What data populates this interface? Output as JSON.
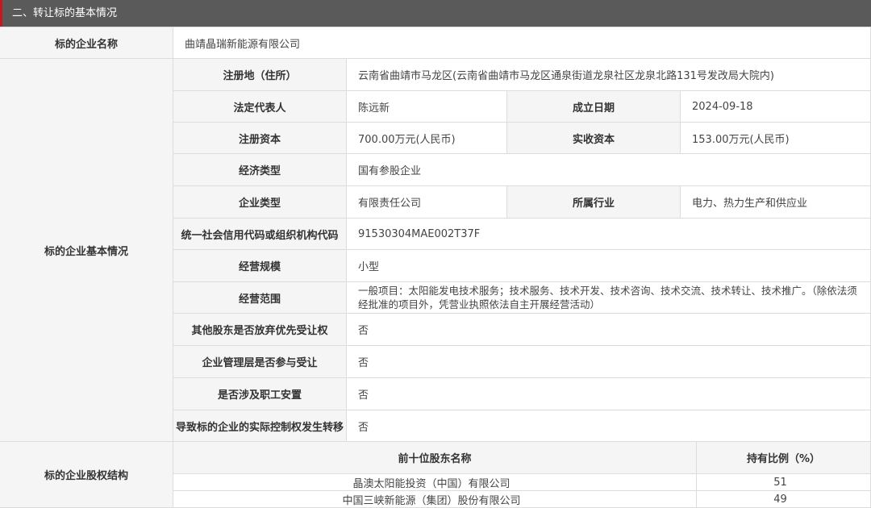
{
  "section": {
    "title": "二、转让标的基本情况"
  },
  "company_name": {
    "label": "标的企业名称",
    "value": "曲靖晶瑞新能源有限公司"
  },
  "basic": {
    "group_label": "标的企业基本情况",
    "registered_address": {
      "label": "注册地（住所）",
      "value": "云南省曲靖市马龙区(云南省曲靖市马龙区通泉街道龙泉社区龙泉北路131号发改局大院内)"
    },
    "legal_rep": {
      "label": "法定代表人",
      "value": "陈远新"
    },
    "established": {
      "label": "成立日期",
      "value": "2024-09-18"
    },
    "registered_capital": {
      "label": "注册资本",
      "value": "700.00万元(人民币)"
    },
    "paid_capital": {
      "label": "实收资本",
      "value": "153.00万元(人民币)"
    },
    "economic_type": {
      "label": "经济类型",
      "value": "国有参股企业"
    },
    "enterprise_type": {
      "label": "企业类型",
      "value": "有限责任公司"
    },
    "industry": {
      "label": "所属行业",
      "value": "电力、热力生产和供应业"
    },
    "credit_code": {
      "label": "统一社会信用代码或组织机构代码",
      "value": "91530304MAE002T37F"
    },
    "scale": {
      "label": "经营规模",
      "value": "小型"
    },
    "business_scope": {
      "label": "经营范围",
      "value": "一般项目：太阳能发电技术服务；技术服务、技术开发、技术咨询、技术交流、技术转让、技术推广。（除依法须经批准的项目外，凭营业执照依法自主开展经营活动）"
    },
    "waive_preemption": {
      "label": "其他股东是否放弃优先受让权",
      "value": "否"
    },
    "mgmt_participate": {
      "label": "企业管理层是否参与受让",
      "value": "否"
    },
    "staff_resettlement": {
      "label": "是否涉及职工安置",
      "value": "否"
    },
    "control_transfer": {
      "label": "导致标的企业的实际控制权发生转移",
      "value": "否"
    }
  },
  "equity": {
    "group_label": "标的企业股权结构",
    "col_name": "前十位股东名称",
    "col_ratio": "持有比例（%）",
    "rows": [
      {
        "name": "晶澳太阳能投资（中国）有限公司",
        "ratio": "51"
      },
      {
        "name": "中国三峡新能源（集团）股份有限公司",
        "ratio": "49"
      }
    ]
  }
}
